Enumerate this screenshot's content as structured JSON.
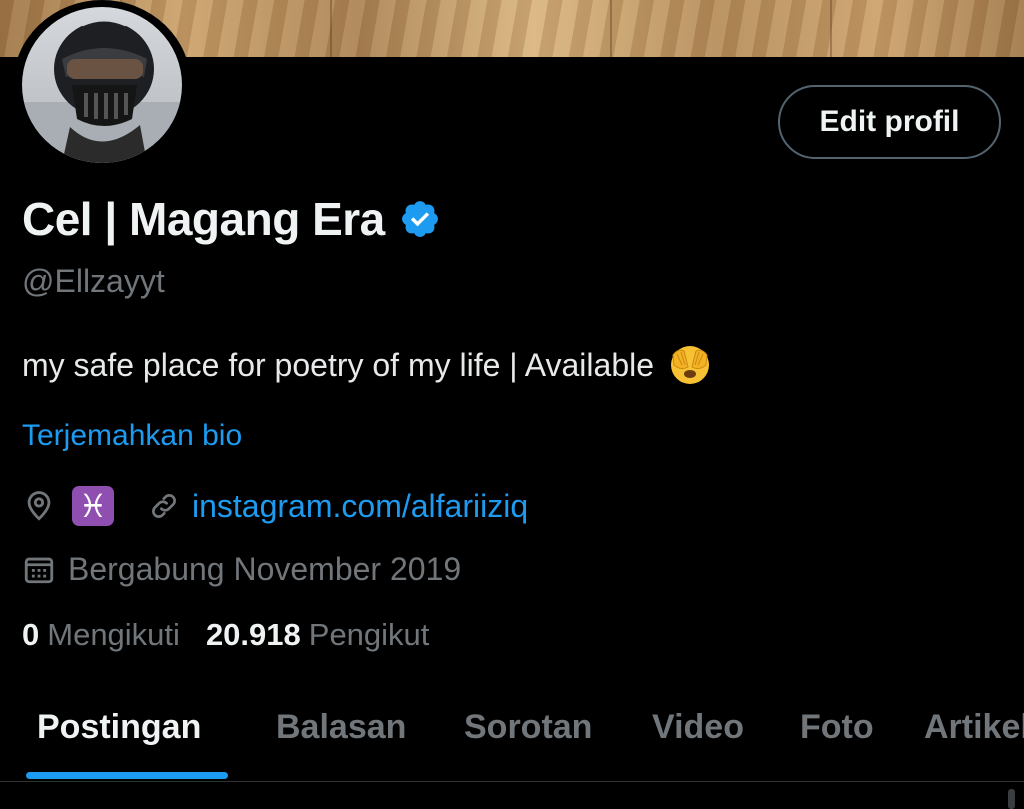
{
  "profile": {
    "display_name": "Cel | Magang Era",
    "handle": "@Ellzayyt",
    "bio": "my safe place for poetry of my life | Available",
    "translate_bio": "Terjemahkan bio",
    "zodiac_symbol": "♓",
    "link": "instagram.com/alfariiziq",
    "joined": "Bergabung November 2019",
    "following_count": "0",
    "following_label": "Mengikuti",
    "followers_count": "20.918",
    "followers_label": "Pengikut",
    "edit_button": "Edit profil"
  },
  "tabs": [
    {
      "label": "Postingan",
      "active": true
    },
    {
      "label": "Balasan",
      "active": false
    },
    {
      "label": "Sorotan",
      "active": false
    },
    {
      "label": "Video",
      "active": false
    },
    {
      "label": "Foto",
      "active": false
    },
    {
      "label": "Artikel",
      "active": false
    }
  ],
  "colors": {
    "background": "#000000",
    "accent": "#1d9bf0",
    "muted": "#71767b",
    "text": "#e7e9ea",
    "zodiac_badge": "#8e4fb0"
  },
  "icons": {
    "verified": "verified-badge-icon",
    "bio_emoji": "face-covering-eyes-emoji-icon",
    "location": "location-pin-icon",
    "link": "link-icon",
    "calendar": "calendar-icon"
  }
}
